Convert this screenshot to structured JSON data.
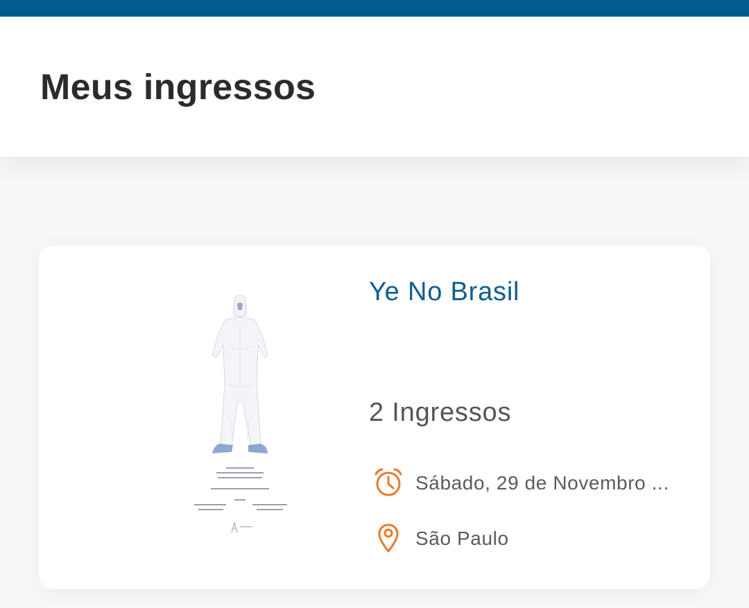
{
  "page": {
    "title": "Meus ingressos"
  },
  "colors": {
    "top_bar": "#005b8f",
    "event_title": "#0d5f8c",
    "icon_accent": "#e8792b"
  },
  "ticket": {
    "event_name": "Ye No Brasil",
    "ticket_count": "2 Ingressos",
    "date": "Sábado, 29 de Novembro ...",
    "location": "São Paulo",
    "date_icon": "alarm-clock-icon",
    "location_icon": "map-pin-icon",
    "poster_image": "event-poster-image"
  }
}
